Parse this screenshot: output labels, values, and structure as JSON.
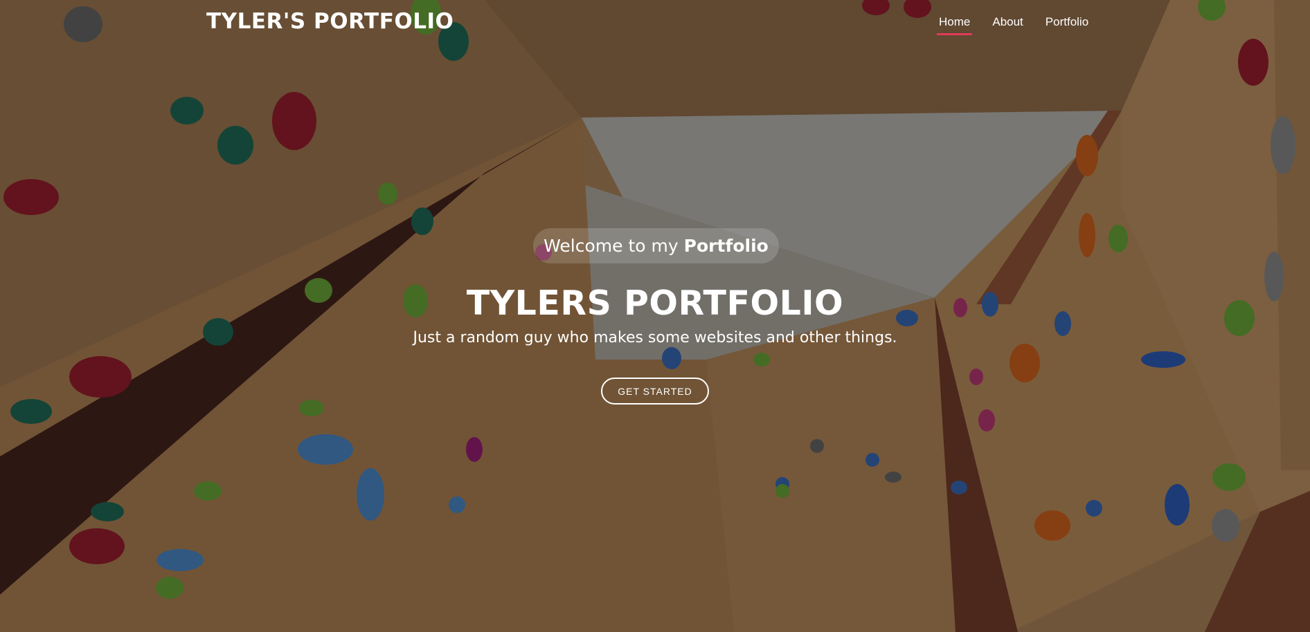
{
  "header": {
    "logo": "TYLER'S PORTFOLIO",
    "nav": [
      {
        "label": "Home",
        "active": true
      },
      {
        "label": "About",
        "active": false
      },
      {
        "label": "Portfolio",
        "active": false
      }
    ]
  },
  "hero": {
    "welcome_prefix": "Welcome to my",
    "welcome_strong": "Portfolio",
    "title": "TYLERS PORTFOLIO",
    "subtitle": "Just a random guy who makes some websites and other things.",
    "cta_label": "GET STARTED"
  },
  "colors": {
    "accent": "#e03a5a",
    "text": "#ffffff"
  }
}
